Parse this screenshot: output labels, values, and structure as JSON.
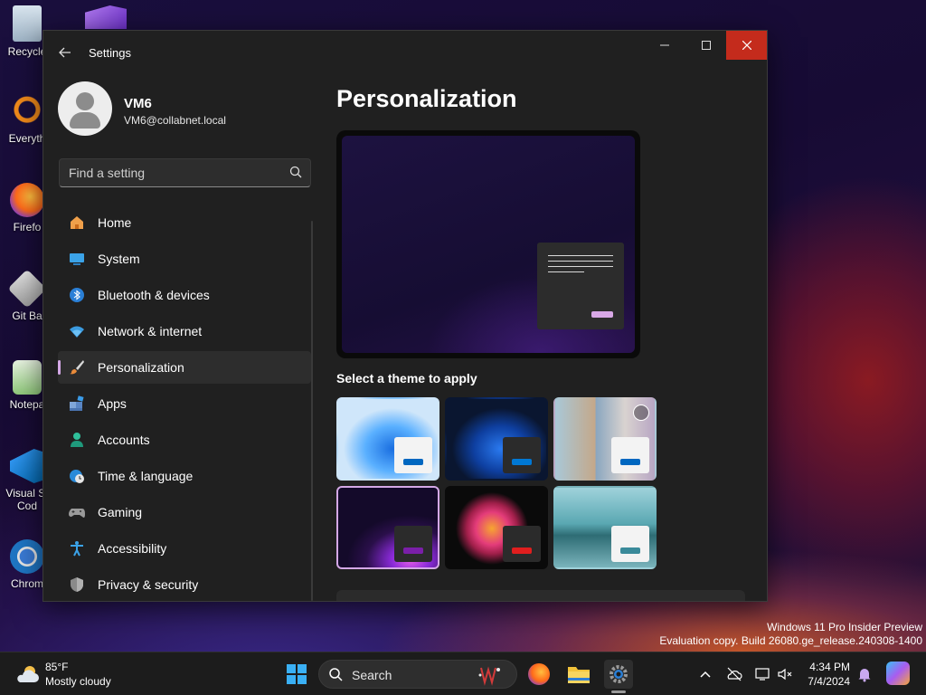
{
  "desktop": {
    "icons": [
      {
        "label": "Recycle"
      },
      {
        "label": "Everyth"
      },
      {
        "label": "Firefo"
      },
      {
        "label": "Git Ba"
      },
      {
        "label": "Notepa"
      },
      {
        "label": "Visual St"
      },
      {
        "label": "Cod"
      },
      {
        "label": "Chrom"
      }
    ]
  },
  "window": {
    "title": "Settings"
  },
  "profile": {
    "name": "VM6",
    "email": "VM6@collabnet.local"
  },
  "search": {
    "placeholder": "Find a setting"
  },
  "nav": {
    "items": [
      {
        "label": "Home",
        "icon": "home-icon"
      },
      {
        "label": "System",
        "icon": "system-icon"
      },
      {
        "label": "Bluetooth & devices",
        "icon": "bluetooth-icon"
      },
      {
        "label": "Network & internet",
        "icon": "wifi-icon"
      },
      {
        "label": "Personalization",
        "icon": "paintbrush-icon",
        "selected": true
      },
      {
        "label": "Apps",
        "icon": "apps-icon"
      },
      {
        "label": "Accounts",
        "icon": "accounts-icon"
      },
      {
        "label": "Time & language",
        "icon": "globe-clock-icon"
      },
      {
        "label": "Gaming",
        "icon": "gamepad-icon"
      },
      {
        "label": "Accessibility",
        "icon": "accessibility-icon"
      },
      {
        "label": "Privacy & security",
        "icon": "shield-icon"
      }
    ]
  },
  "main": {
    "title": "Personalization",
    "themes_label": "Select a theme to apply",
    "themes": [
      {
        "name": "windows-light",
        "selected": false
      },
      {
        "name": "windows-dark",
        "selected": false
      },
      {
        "name": "windows-spotlight",
        "selected": false
      },
      {
        "name": "glow",
        "selected": true
      },
      {
        "name": "captured-motion",
        "selected": false
      },
      {
        "name": "flow",
        "selected": false
      }
    ]
  },
  "watermark": {
    "line1": "Windows 11 Pro Insider Preview",
    "line2": "Evaluation copy. Build 26080.ge_release.240308-1400"
  },
  "taskbar": {
    "weather_temp": "85°F",
    "weather_cond": "Mostly cloudy",
    "search_label": "Search",
    "time": "4:34 PM",
    "date": "7/4/2024"
  },
  "colors": {
    "accent": "#d4a8e6",
    "close": "#c42b1c",
    "window_bg": "#202020"
  }
}
